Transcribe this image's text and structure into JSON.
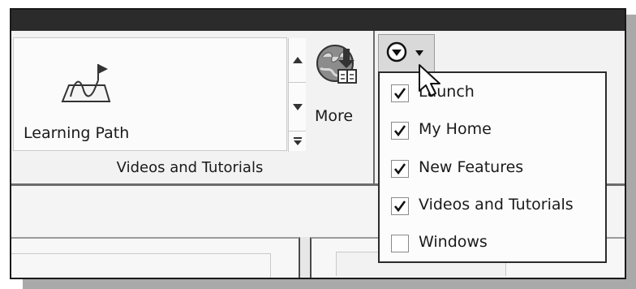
{
  "ribbon": {
    "gallery": {
      "item_label": "Learning Path",
      "icon": "learning-path-icon",
      "scroll_up_icon": "triangle-up-icon",
      "scroll_down_icon": "triangle-down-icon",
      "expand_icon": "gallery-expand-icon"
    },
    "group_label": "Videos and Tutorials",
    "more": {
      "label": "More",
      "icon": "globe-download-icon"
    },
    "customize": {
      "icon": "circle-chevron-down-icon",
      "caret_icon": "caret-down-icon"
    }
  },
  "menu": {
    "items": [
      {
        "label": "Launch",
        "checked": true
      },
      {
        "label": "My Home",
        "checked": true
      },
      {
        "label": "New Features",
        "checked": true
      },
      {
        "label": "Videos and Tutorials",
        "checked": true
      },
      {
        "label": "Windows",
        "checked": false
      }
    ]
  },
  "cursor": {
    "icon": "mouse-pointer-icon"
  },
  "colors": {
    "titlebar": "#2b2b2b",
    "ribbon_bg": "#f2f2f2",
    "menu_bg": "#fcfcfc",
    "button_highlight": "#d9d9d9"
  }
}
